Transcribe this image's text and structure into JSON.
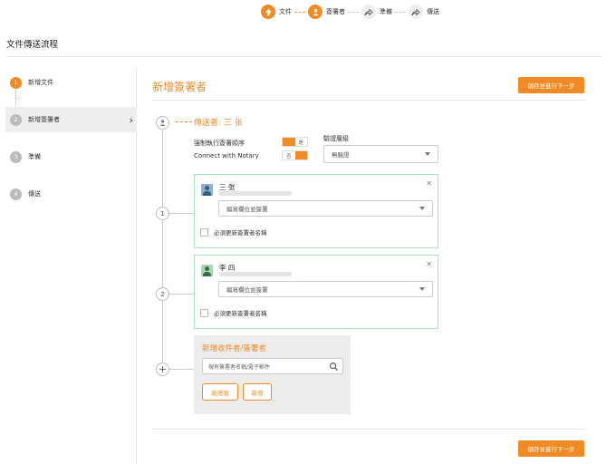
{
  "top_steps": [
    {
      "label": "文件",
      "icon": "upload-icon",
      "active": true
    },
    {
      "label": "簽署者",
      "icon": "person-icon",
      "active": true
    },
    {
      "label": "準備",
      "icon": "share-icon",
      "active": false
    },
    {
      "label": "傳送",
      "icon": "share-icon",
      "active": false
    }
  ],
  "page_title": "文件傳送流程",
  "sidebar": {
    "items": [
      {
        "num": "1",
        "label": "新增文件"
      },
      {
        "num": "2",
        "label": "新增簽署者"
      },
      {
        "num": "3",
        "label": "準備"
      },
      {
        "num": "4",
        "label": "傳送"
      }
    ],
    "chevron": "›"
  },
  "main": {
    "title": "新增簽署者",
    "save_next_label": "儲存並進行下一步"
  },
  "sender": {
    "title": "傳送者: 三 张",
    "force_order_label": "強制執行簽署順序",
    "force_order_on": "是",
    "notary_label": "Connect with Notary",
    "notary_off": "否",
    "verify_level_label": "驗證層級",
    "verify_level_value": "無驗證"
  },
  "signers": [
    {
      "num": "1",
      "name": "三 张",
      "field_placeholder": "編寫欄位並簽署",
      "require_name_label": "必須更新簽署者名稱"
    },
    {
      "num": "2",
      "name": "李 四",
      "field_placeholder": "編寫欄位並簽署",
      "require_name_label": "必須更新簽署者名稱"
    }
  ],
  "add_panel": {
    "title": "新增收件者/簽署者",
    "search_placeholder": "現有簽署者名稱/電子郵件",
    "add_me_label": "新增我",
    "add_label": "新增"
  },
  "colors": {
    "accent": "#f08a24",
    "signer_border": "#a8e4c0"
  }
}
